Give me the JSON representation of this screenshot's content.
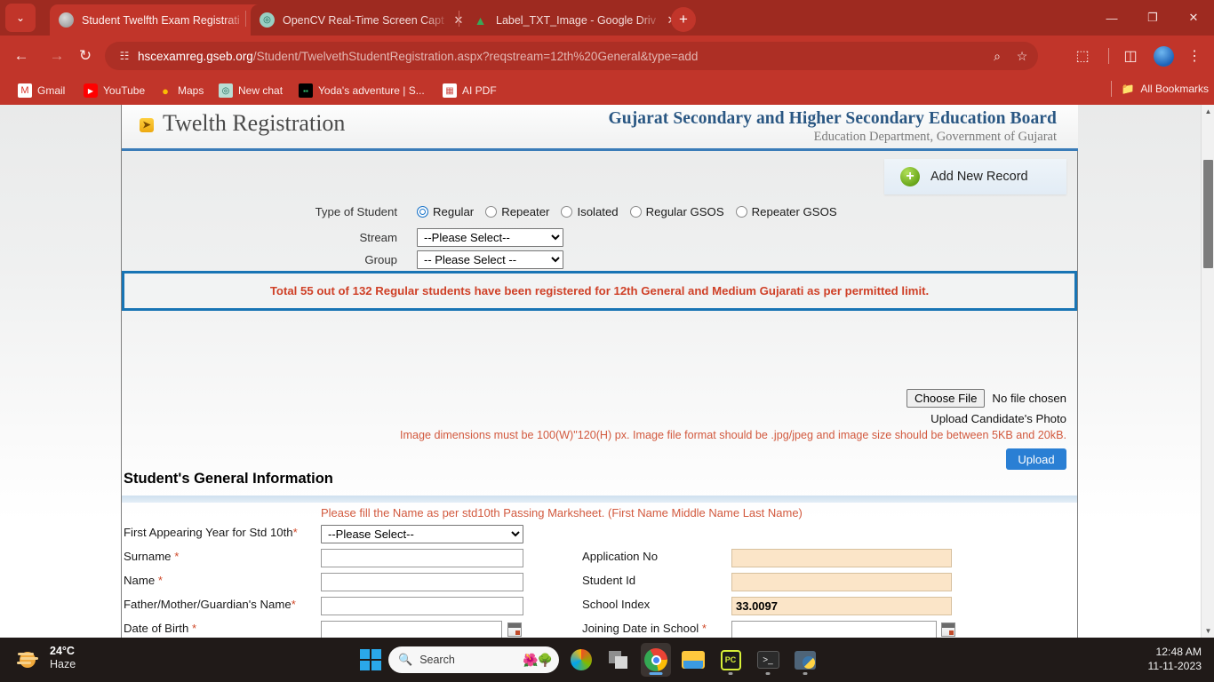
{
  "browser": {
    "tabs": [
      {
        "title": "Student Twelfth Exam Registrati",
        "favicon": "gseb-icon",
        "active": true
      },
      {
        "title": "OpenCV Real-Time Screen Capt",
        "favicon": "chatgpt-icon",
        "active": false
      },
      {
        "title": "Label_TXT_Image - Google Driv",
        "favicon": "google-drive-icon",
        "active": false
      }
    ],
    "newtab_label": "+",
    "tab_list_label": "⌄",
    "window_controls": {
      "minimize": "—",
      "maximize": "❐",
      "close": "✕"
    },
    "nav": {
      "back": "←",
      "forward": "→",
      "reload": "↻"
    },
    "url_domain": "hscexamreg.gseb.org",
    "url_path": "/Student/TwelvethStudentRegistration.aspx?reqstream=12th%20General&type=add",
    "omnibox_icons": {
      "site_settings": "☷",
      "search": "⌕",
      "bookmark": "☆"
    },
    "toolbar_icons": {
      "extensions": "⬚",
      "side_panel": "◫",
      "profile": "profile-avatar-icon",
      "menu": "⋮"
    },
    "bookmarks": [
      {
        "label": "Gmail",
        "icon": "gmail-icon"
      },
      {
        "label": "YouTube",
        "icon": "youtube-icon"
      },
      {
        "label": "Maps",
        "icon": "google-maps-icon"
      },
      {
        "label": "New chat",
        "icon": "chatgpt-icon"
      },
      {
        "label": "Yoda's adventure | S...",
        "icon": "yoda-icon"
      },
      {
        "label": "AI PDF",
        "icon": "ai-pdf-icon"
      }
    ],
    "all_bookmarks_label": "All Bookmarks",
    "all_bookmarks_icon": "folder-icon"
  },
  "page": {
    "header": {
      "title": "Twelth Registration",
      "board_name": "Gujarat Secondary and Higher Secondary Education Board",
      "department": "Education Department, Government of Gujarat"
    },
    "add_new_record": {
      "label": "Add New Record",
      "icon": "plus-circle-icon"
    },
    "type_of_student": {
      "label": "Type of Student",
      "options": [
        {
          "label": "Regular",
          "selected": true
        },
        {
          "label": "Repeater",
          "selected": false
        },
        {
          "label": "Isolated",
          "selected": false
        },
        {
          "label": "Regular GSOS",
          "selected": false
        },
        {
          "label": "Repeater GSOS",
          "selected": false
        }
      ]
    },
    "stream": {
      "label": "Stream",
      "value": "--Please Select--"
    },
    "group": {
      "label": "Group",
      "value": "-- Please Select --"
    },
    "alert": "Total 55 out of 132 Regular students have been registered for 12th General and Medium Gujarati as per permitted limit.",
    "upload": {
      "choose_file_label": "Choose File",
      "no_file_text": "No file chosen",
      "caption": "Upload Candidate's Photo",
      "note": "Image dimensions must be 100(W)\"120(H) px. Image file format should be .jpg/jpeg and image size should be between 5KB and 20kB.",
      "button_label": "Upload"
    },
    "section_title": "Student's General Information",
    "name_note": "Please fill the Name as per std10th Passing Marksheet. (First Name Middle Name Last Name)",
    "form_rows": [
      {
        "left_label": "First Appearing Year for Std 10th",
        "left_required": "*",
        "left_type": "select",
        "left_value": "--Please Select--",
        "right_label": "",
        "right_type": "none",
        "right_value": ""
      },
      {
        "left_label": "Surname ",
        "left_required": "*",
        "left_type": "text",
        "left_value": "",
        "right_label": "Application No",
        "right_required": "",
        "right_type": "locked",
        "right_value": ""
      },
      {
        "left_label": "Name ",
        "left_required": "*",
        "left_type": "text",
        "left_value": "",
        "right_label": "Student Id",
        "right_required": "",
        "right_type": "locked",
        "right_value": ""
      },
      {
        "left_label": "Father/Mother/Guardian's Name",
        "left_required": "*",
        "left_type": "text",
        "left_value": "",
        "right_label": "School Index",
        "right_required": "",
        "right_type": "locked",
        "right_value": "33.0097"
      },
      {
        "left_label": "Date of Birth ",
        "left_required": "*",
        "left_type": "date",
        "left_value": "",
        "right_label": "Joining Date in School ",
        "right_required": "*",
        "right_type": "date",
        "right_value": ""
      }
    ],
    "scrollbar": {
      "up_arrow": "▲",
      "down_arrow": "▼"
    }
  },
  "taskbar": {
    "weather": {
      "temperature": "24°C",
      "condition": "Haze",
      "icon": "haze-icon"
    },
    "start_label": "windows-start-icon",
    "search": {
      "placeholder": "Search",
      "icon": "search-icon",
      "decoration": "🌺🌳"
    },
    "apps": [
      {
        "name": "microsoft-365-copilot-icon",
        "active": false,
        "running": false
      },
      {
        "name": "task-view-icon",
        "active": false,
        "running": false
      },
      {
        "name": "google-chrome-icon",
        "active": true,
        "running": true
      },
      {
        "name": "file-explorer-icon",
        "active": false,
        "running": false
      },
      {
        "name": "pycharm-icon",
        "active": false,
        "running": true
      },
      {
        "name": "terminal-icon",
        "active": false,
        "running": true
      },
      {
        "name": "python-idle-icon",
        "active": false,
        "running": true
      }
    ],
    "clock": {
      "time": "12:48 AM",
      "date": "11-11-2023"
    }
  }
}
